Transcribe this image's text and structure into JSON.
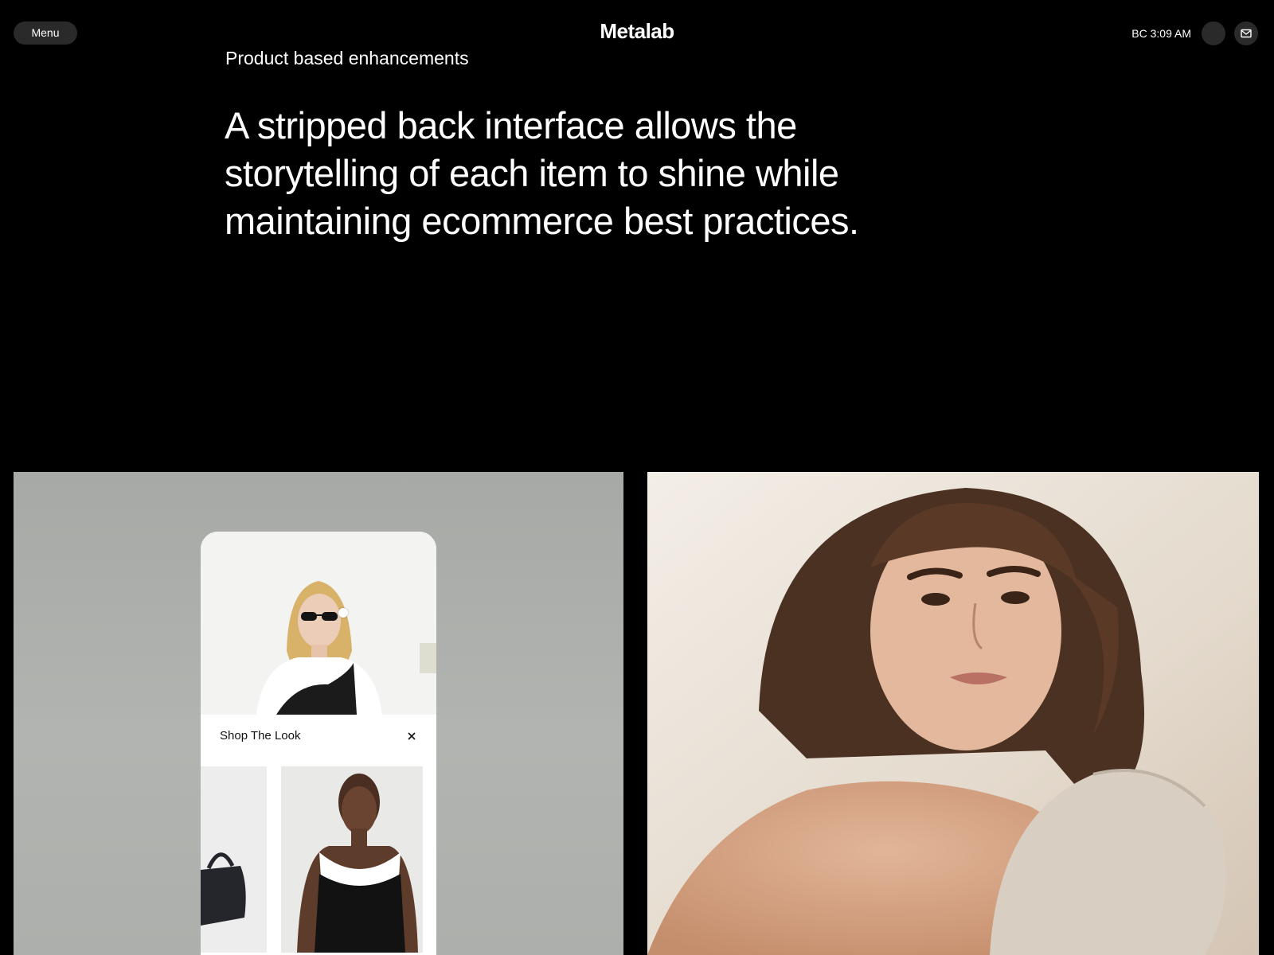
{
  "header": {
    "menu_label": "Menu",
    "brand": "Metalab",
    "clock": "BC 3:09 AM",
    "icons": [
      "moon-icon",
      "mail-icon"
    ]
  },
  "intro": {
    "eyebrow": "Product based enhancements",
    "headline": "A stripped back interface allows the storytelling of each item to shine while maintaining ecommerce best practices."
  },
  "showcase": {
    "shop_the_look": {
      "title": "Shop The Look",
      "close_icon": "close-icon"
    }
  },
  "colors": {
    "background": "#000000",
    "text": "#ffffff",
    "pill": "#2a2a2a",
    "left_panel": "#adafac"
  }
}
